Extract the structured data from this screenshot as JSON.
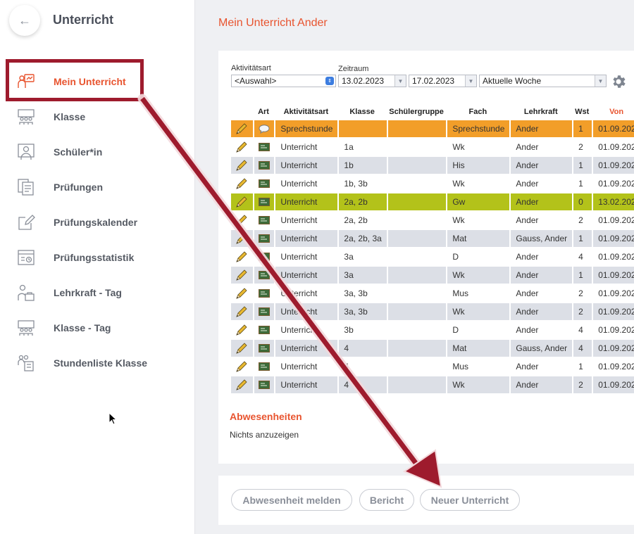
{
  "sidebar": {
    "title": "Unterricht",
    "items": [
      {
        "label": "Mein Unterricht",
        "icon": "teacher-board-icon",
        "active": true
      },
      {
        "label": "Klasse",
        "icon": "class-group-icon"
      },
      {
        "label": "Schüler*in",
        "icon": "student-icon"
      },
      {
        "label": "Prüfungen",
        "icon": "exam-documents-icon"
      },
      {
        "label": "Prüfungskalender",
        "icon": "edit-calendar-icon"
      },
      {
        "label": "Prüfungsstatistik",
        "icon": "statistics-icon"
      },
      {
        "label": "Lehrkraft - Tag",
        "icon": "teacher-day-icon"
      },
      {
        "label": "Klasse - Tag",
        "icon": "class-day-icon"
      },
      {
        "label": "Stundenliste Klasse",
        "icon": "class-list-icon"
      }
    ]
  },
  "main": {
    "title": "Mein Unterricht Ander",
    "filters": {
      "activity_label": "Aktivitätsart",
      "activity_value": "<Auswahl>",
      "period_label": "Zeitraum",
      "date_from": "13.02.2023",
      "date_to": "17.02.2023",
      "period_value": "Aktuelle Woche"
    },
    "table": {
      "headers": [
        "",
        "Art",
        "Aktivitätsart",
        "Klasse",
        "Schülergruppe",
        "Fach",
        "Lehrkraft",
        "Wst",
        "Von"
      ],
      "rows": [
        {
          "art": "speech",
          "activity": "Sprechstunde",
          "klasse": "",
          "gruppe": "",
          "fach": "Sprechstunde",
          "lehrkraft": "Ander",
          "wst": "1",
          "von": "01.09.202",
          "style": "orange"
        },
        {
          "art": "board",
          "activity": "Unterricht",
          "klasse": "1a",
          "gruppe": "",
          "fach": "Wk",
          "lehrkraft": "Ander",
          "wst": "2",
          "von": "01.09.202",
          "style": "odd"
        },
        {
          "art": "board",
          "activity": "Unterricht",
          "klasse": "1b",
          "gruppe": "",
          "fach": "His",
          "lehrkraft": "Ander",
          "wst": "1",
          "von": "01.09.202",
          "style": "even"
        },
        {
          "art": "board",
          "activity": "Unterricht",
          "klasse": "1b, 3b",
          "gruppe": "",
          "fach": "Wk",
          "lehrkraft": "Ander",
          "wst": "1",
          "von": "01.09.202",
          "style": "odd"
        },
        {
          "art": "board",
          "activity": "Unterricht",
          "klasse": "2a, 2b",
          "gruppe": "",
          "fach": "Gw",
          "lehrkraft": "Ander",
          "wst": "0",
          "von": "13.02.202",
          "style": "green"
        },
        {
          "art": "board",
          "activity": "Unterricht",
          "klasse": "2a, 2b",
          "gruppe": "",
          "fach": "Wk",
          "lehrkraft": "Ander",
          "wst": "2",
          "von": "01.09.202",
          "style": "odd"
        },
        {
          "art": "board",
          "activity": "Unterricht",
          "klasse": "2a, 2b, 3a",
          "gruppe": "",
          "fach": "Mat",
          "lehrkraft": "Gauss, Ander",
          "wst": "1",
          "von": "01.09.202",
          "style": "even"
        },
        {
          "art": "board",
          "activity": "Unterricht",
          "klasse": "3a",
          "gruppe": "",
          "fach": "D",
          "lehrkraft": "Ander",
          "wst": "4",
          "von": "01.09.202",
          "style": "odd"
        },
        {
          "art": "board",
          "activity": "Unterricht",
          "klasse": "3a",
          "gruppe": "",
          "fach": "Wk",
          "lehrkraft": "Ander",
          "wst": "1",
          "von": "01.09.202",
          "style": "even"
        },
        {
          "art": "board",
          "activity": "Unterricht",
          "klasse": "3a, 3b",
          "gruppe": "",
          "fach": "Mus",
          "lehrkraft": "Ander",
          "wst": "2",
          "von": "01.09.202",
          "style": "odd"
        },
        {
          "art": "board",
          "activity": "Unterricht",
          "klasse": "3a, 3b",
          "gruppe": "",
          "fach": "Wk",
          "lehrkraft": "Ander",
          "wst": "2",
          "von": "01.09.202",
          "style": "even"
        },
        {
          "art": "board",
          "activity": "Unterricht",
          "klasse": "3b",
          "gruppe": "",
          "fach": "D",
          "lehrkraft": "Ander",
          "wst": "4",
          "von": "01.09.202",
          "style": "odd"
        },
        {
          "art": "board",
          "activity": "Unterricht",
          "klasse": "4",
          "gruppe": "",
          "fach": "Mat",
          "lehrkraft": "Gauss, Ander",
          "wst": "4",
          "von": "01.09.202",
          "style": "even"
        },
        {
          "art": "board",
          "activity": "Unterricht",
          "klasse": "4",
          "gruppe": "",
          "fach": "Mus",
          "lehrkraft": "Ander",
          "wst": "1",
          "von": "01.09.202",
          "style": "odd"
        },
        {
          "art": "board",
          "activity": "Unterricht",
          "klasse": "4",
          "gruppe": "",
          "fach": "Wk",
          "lehrkraft": "Ander",
          "wst": "2",
          "von": "01.09.202",
          "style": "even"
        }
      ]
    },
    "absences": {
      "title": "Abwesenheiten",
      "empty_text": "Nichts anzuzeigen"
    },
    "buttons": {
      "report_absence": "Abwesenheit melden",
      "report": "Bericht",
      "new_lesson": "Neuer Unterricht"
    }
  },
  "colors": {
    "accent": "#e8542f",
    "highlight_red": "#9e1b2d",
    "row_orange": "#f29e29",
    "row_green": "#b3c21a"
  }
}
